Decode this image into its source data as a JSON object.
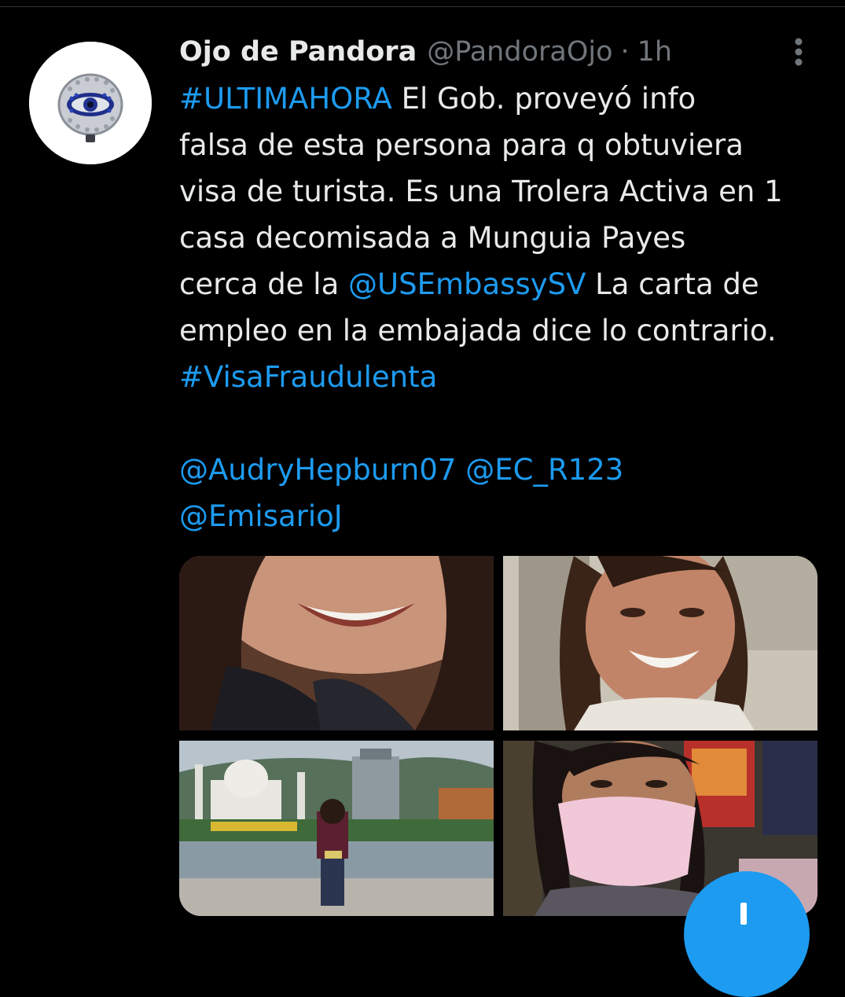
{
  "tweet": {
    "author_name": "Ojo de Pandora",
    "author_handle": "@PandoraOjo",
    "separator": "·",
    "timestamp": "1h",
    "text": {
      "line1_hashtag": "#ULTIMAHORA",
      "line1_rest": " El Gob. proveyó info",
      "line2": "falsa de esta persona para q obtuviera",
      "line3": "visa de turista. Es una Trolera Activa en 1",
      "line4": "casa decomisada a  Munguia Payes",
      "line5_pre": "cerca de la ",
      "line5_mention": "@USEmbassySV",
      "line5_rest": " La carta de",
      "line6": "empleo en la embajada dice lo contrario.",
      "line7_hashtag": "#VisaFraudulenta",
      "mention1": "@AudryHepburn07",
      "mention2": "@EC_R123",
      "mention3": "@EmisarioJ"
    }
  },
  "colors": {
    "background": "#000000",
    "text_primary": "#e7e9ea",
    "text_secondary": "#71767b",
    "link": "#1d9bf0",
    "divider": "#2f3336"
  },
  "icons": {
    "more": "more-vertical-icon",
    "compose": "compose-plus-icon",
    "avatar": "evil-eye-bead-avatar"
  }
}
